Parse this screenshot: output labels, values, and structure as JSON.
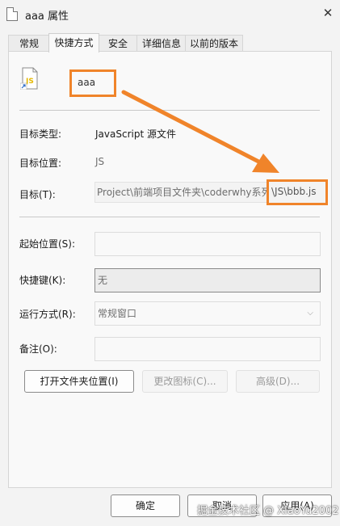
{
  "window": {
    "title": "aaa 属性",
    "close_glyph": "✕"
  },
  "tabs": [
    "常规",
    "快捷方式",
    "安全",
    "详细信息",
    "以前的版本"
  ],
  "active_tab": "快捷方式",
  "file": {
    "name": "aaa",
    "icon_text": "JS"
  },
  "rows": {
    "target_type_label": "目标类型:",
    "target_type_value": "JavaScript 源文件",
    "target_location_label": "目标位置:",
    "target_location_value": "JS",
    "target_label": "目标(T):",
    "target_value": "Project\\前端项目文件夹\\coderwhy系列",
    "target_value_end": "\\JS\\bbb.js",
    "start_in_label": "起始位置(S):",
    "start_in_value": "",
    "hotkey_label": "快捷键(K):",
    "hotkey_value": "无",
    "run_label": "运行方式(R):",
    "run_value": "常规窗口",
    "comment_label": "备注(O):",
    "comment_value": ""
  },
  "buttons": {
    "open_location": "打开文件夹位置(I)",
    "change_icon": "更改图标(C)...",
    "advanced": "高级(D)...",
    "ok": "确定",
    "cancel": "取消",
    "apply": "应用(A)"
  },
  "watermark": "掘金技术社区 @ XiaoYu2002",
  "colors": {
    "annotation": "#f0842a"
  }
}
